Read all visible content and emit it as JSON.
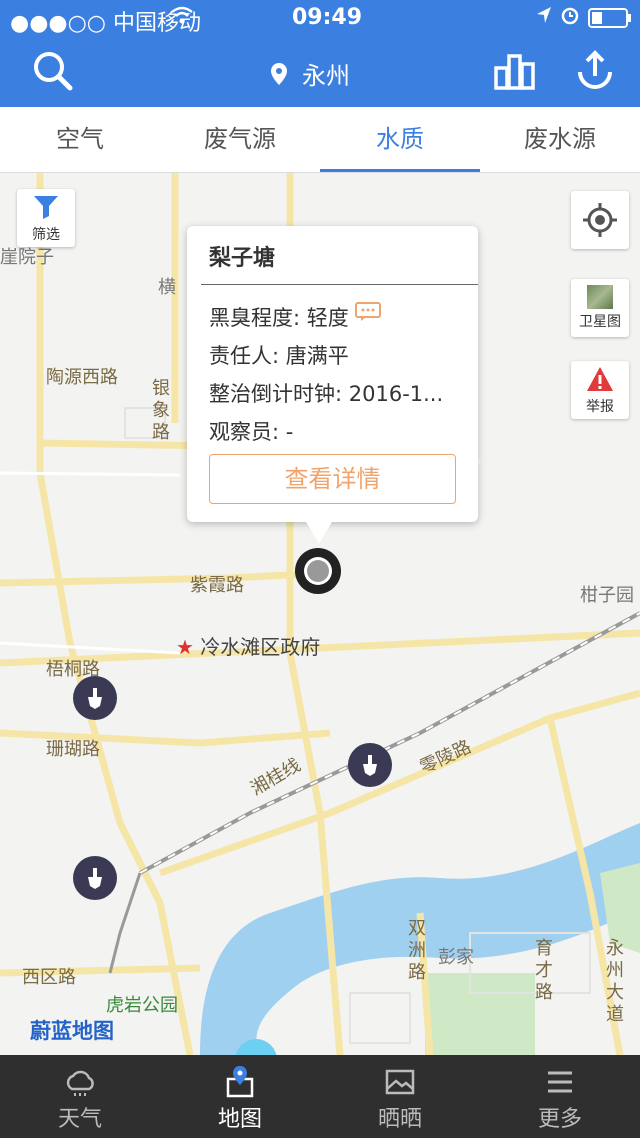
{
  "status": {
    "carrier": "●●●○○ 中国移动",
    "time": "09:49"
  },
  "header": {
    "city": "永州"
  },
  "tabs": [
    {
      "label": "空气"
    },
    {
      "label": "废气源"
    },
    {
      "label": "水质",
      "active": true
    },
    {
      "label": "废水源"
    }
  ],
  "map_labels": {
    "yuanzi": "崖院子",
    "heng": "横",
    "taoyuan": "陶源西路",
    "yinxiang": "银象路",
    "zixia": "紫霞路",
    "ganziyuan": "柑子园",
    "gov": "冷水滩区政府",
    "wutong": "梧桐路",
    "shanhu": "珊瑚路",
    "xianggui": "湘桂线",
    "lingling": "零陵路",
    "shuangzhou": "双洲路",
    "pengjia": "彭家",
    "yucai": "育才路",
    "yongzhou_ave": "永州大道",
    "xiqu": "西区路",
    "huyan": "虎岩公园",
    "brand": "蔚蓝地图"
  },
  "side_buttons": {
    "filter": "筛选",
    "satellite": "卫星图",
    "report": "举报"
  },
  "popup": {
    "title": "梨子塘",
    "line1": "黑臭程度: 轻度",
    "line2": "责任人: 唐满平",
    "line3": "整治倒计时钟: 2016-1...",
    "line4": "观察员: -",
    "button": "查看详情"
  },
  "bottom_tabs": [
    {
      "label": "天气",
      "icon": "cloud-icon"
    },
    {
      "label": "地图",
      "icon": "map-icon",
      "active": true
    },
    {
      "label": "晒晒",
      "icon": "photo-icon"
    },
    {
      "label": "更多",
      "icon": "menu-icon"
    }
  ],
  "colors": {
    "accent": "#3b7fe0",
    "orange": "#f0a46b",
    "river": "#9fd0f0"
  }
}
